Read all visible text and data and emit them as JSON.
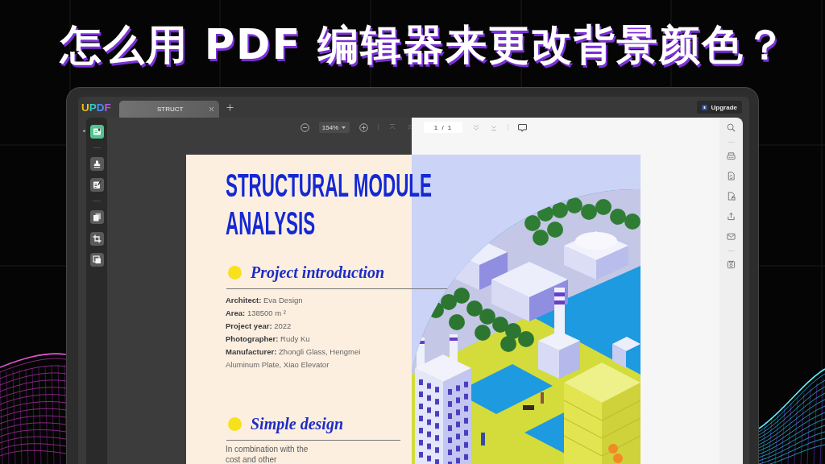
{
  "headline": "怎么用 PDF 编辑器来更改背景颜色？",
  "app": {
    "logo": "UPDF",
    "tabs": [
      {
        "label": "STRUCT",
        "selected": true
      }
    ],
    "upgrade_button": "Upgrade",
    "left_toolbar": {
      "groups": [
        [
          {
            "selected": true
          }
        ],
        [
          {
            "selected": false
          },
          {
            "selected": false
          }
        ],
        [
          {
            "selected": false
          },
          {
            "selected": false
          },
          {
            "selected": false
          }
        ]
      ]
    },
    "toolbar": {
      "zoom": "154%",
      "page": "1 / 1",
      "nav_buttons": [
        {
          "disabled": true
        },
        {
          "disabled": true
        },
        {
          "disabled": true
        },
        {
          "disabled": true
        }
      ]
    },
    "document": {
      "title": "STRUCTURAL MODULE ANALYSIS",
      "sections": [
        {
          "kind": "facts",
          "heading": "Project introduction",
          "lines": [
            "**Architect:** Eva Design",
            "**Area:** 138500 m ²",
            "**Project year:** 2022",
            "**Photographer:** Rudy Ku",
            "**Manufacturer:** Zhongli Glass, Hengmei Aluminum Plate, Xiao Elevator"
          ]
        },
        {
          "kind": "text",
          "heading": "Simple design",
          "lines": [
            "In combination with the cost and other"
          ]
        }
      ]
    }
  }
}
